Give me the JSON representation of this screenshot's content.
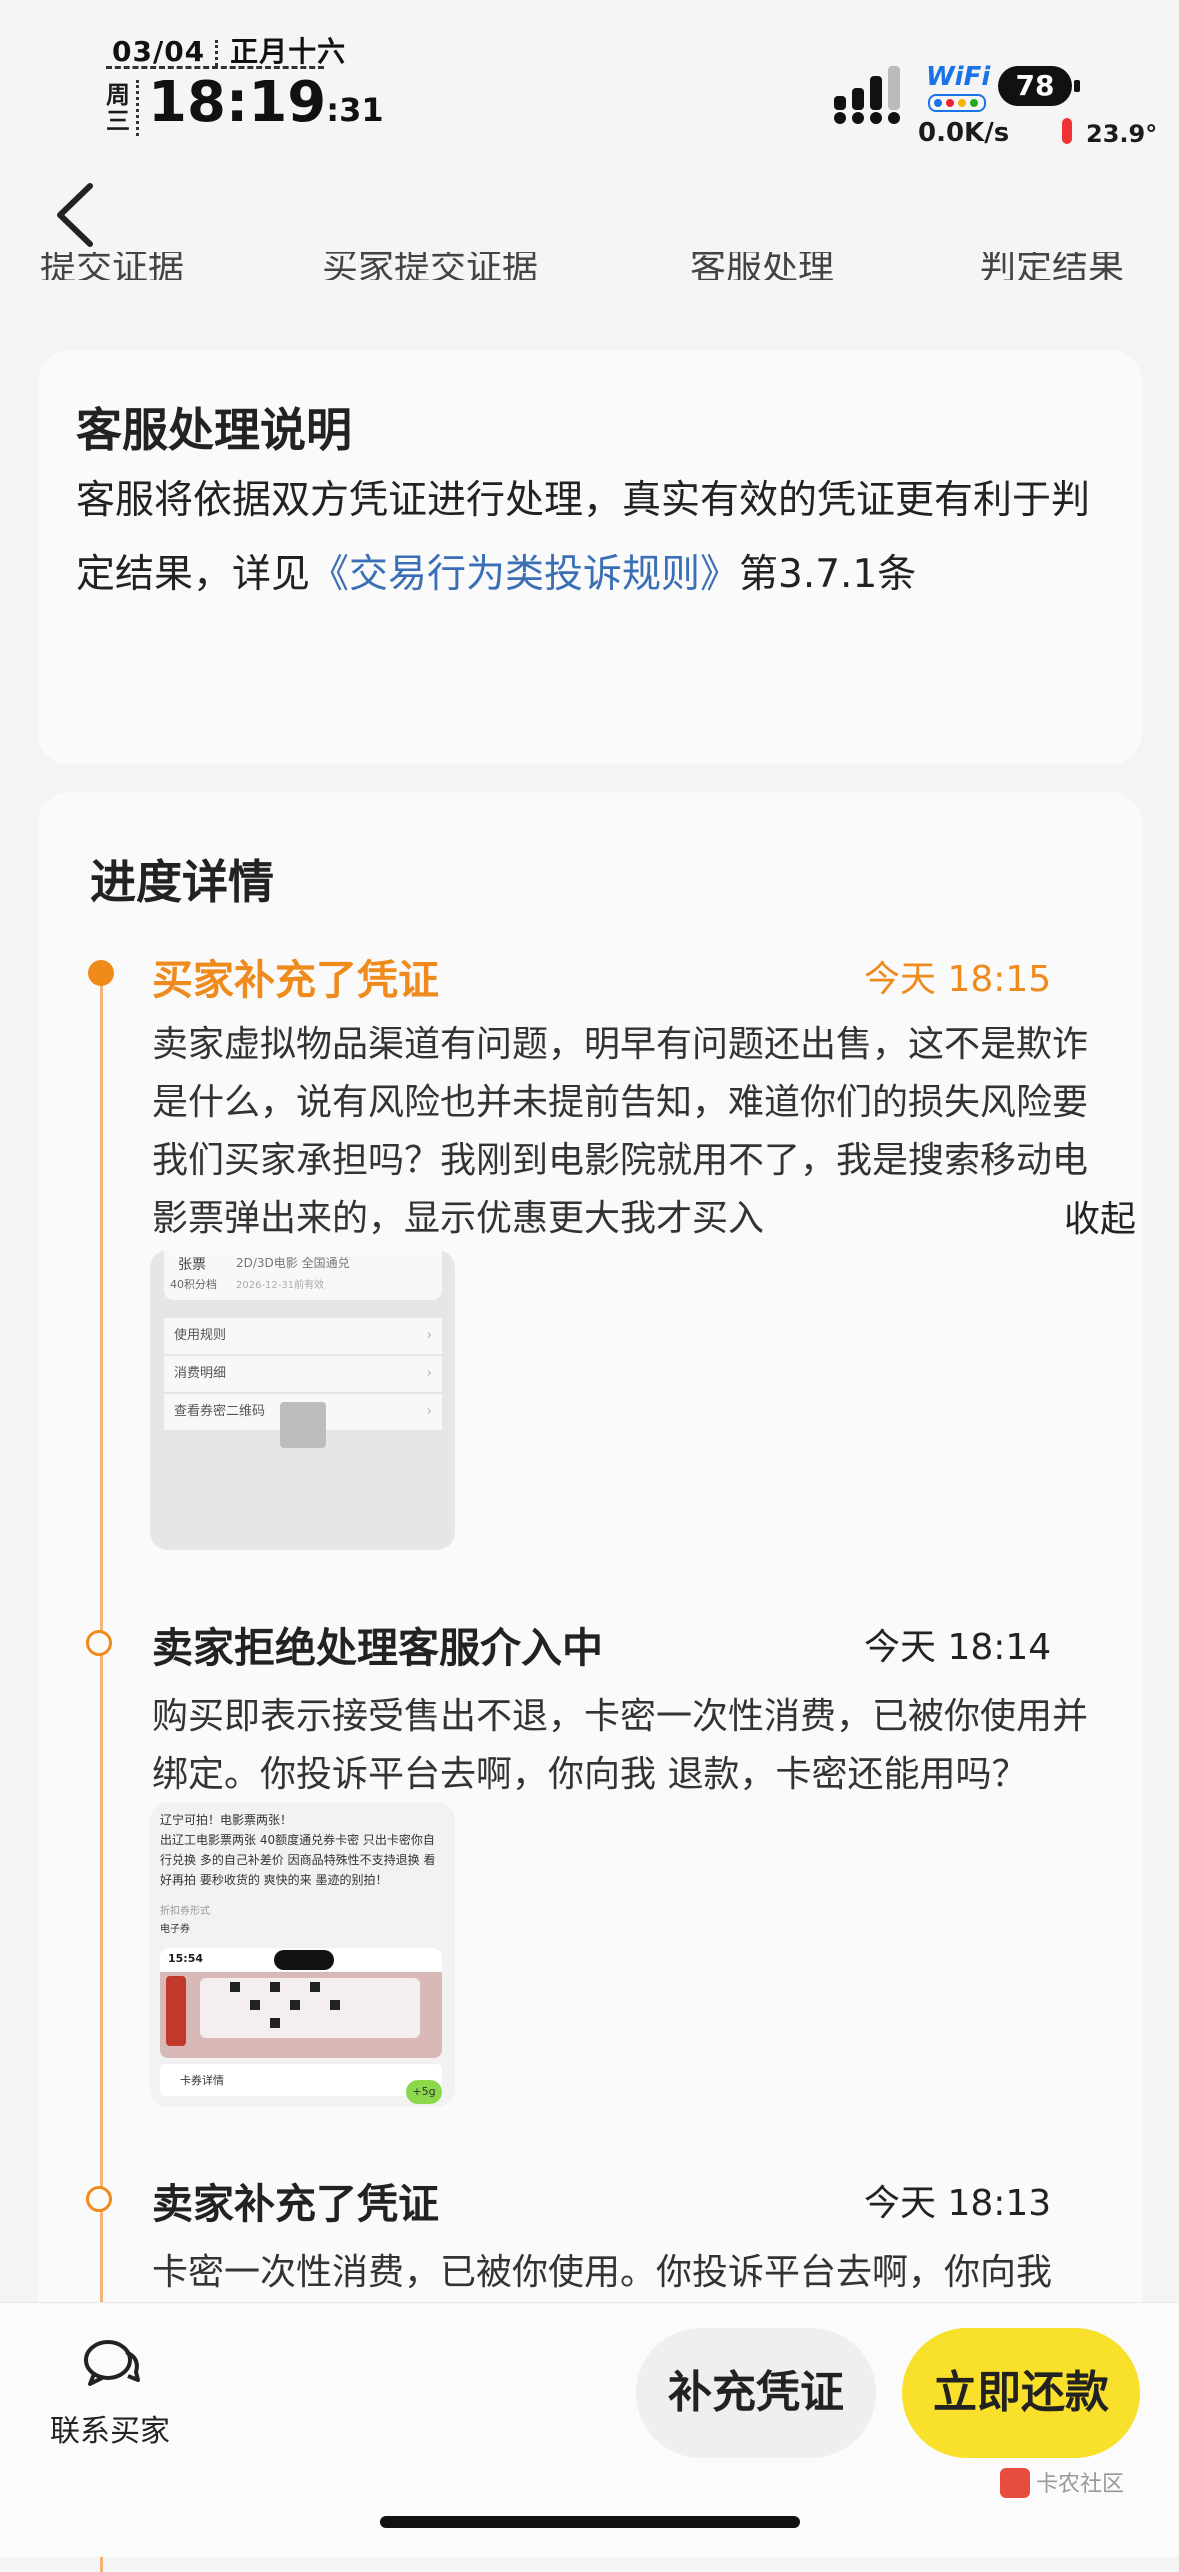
{
  "status_bar": {
    "date": "03/04",
    "lunar": "正月十六",
    "weekday": "周三",
    "time": "18:19",
    "seconds": ":31",
    "wifi": "WiFi",
    "battery": "78",
    "net_speed": "0.0K/s",
    "temperature": "23.9°"
  },
  "nav": {
    "back_icon": "chevron-left-icon",
    "cut_tabs": [
      "提交证据",
      "买家提交证据",
      "客服处理",
      "判定结果"
    ]
  },
  "service_card": {
    "title": "客服处理说明",
    "text_before": "客服将依据双方凭证进行处理，真实有效的凭证更有利于判定结果，详见",
    "link": "《交易行为类投诉规则》",
    "text_after": "第3.7.1条"
  },
  "progress": {
    "title": "进度详情",
    "collapse": "收起",
    "events": [
      {
        "title": "买家补充了凭证",
        "time": "今天 18:15",
        "text": "卖家虚拟物品渠道有问题，明早有问题还出售，这不是欺诈是什么，说有风险也并未提前告知，难道你们的损失风险要我们买家承担吗？我刚到电影院就用不了，我是搜索移动电影票弹出来的，显示优惠更大我才买入",
        "thumb": {
          "top_left": "张票",
          "sub_left": "40积分档",
          "top_right": "2D/3D电影 全国通兑",
          "date": "2026-12-31前有效",
          "rows": [
            "使用规则",
            "消费明细",
            "查看券密二维码"
          ]
        }
      },
      {
        "title": "卖家拒绝处理客服介入中",
        "time": "今天 18:14",
        "text": "购买即表示接受售出不退，卡密一次性消费，已被你使用并绑定。你投诉平台去啊，你向我 退款，卡密还能用吗？",
        "thumb": {
          "lines": [
            "辽宁可拍！电影票两张！",
            "出辽工电影票两张 40额度通兑券卡密 只出卡密你自",
            "行兑换 多的自己补差价 因商品特殊性不支持退换 看",
            "好再拍 要秒收货的 爽快的来 墨迹的别拍！"
          ],
          "sub1": "折扣券形式",
          "sub2": "电子券",
          "phone_time": "15:54",
          "footer": "卡券详情",
          "badge": "+5g"
        }
      },
      {
        "title": "卖家补充了凭证",
        "time": "今天 18:13",
        "text": "卡密一次性消费，已被你使用。你投诉平台去啊，你向我"
      }
    ]
  },
  "bottom_bar": {
    "contact_label": "联系买家",
    "evidence_button": "补充凭证",
    "repay_button": "立即还款",
    "watermark": "卡农社区"
  }
}
